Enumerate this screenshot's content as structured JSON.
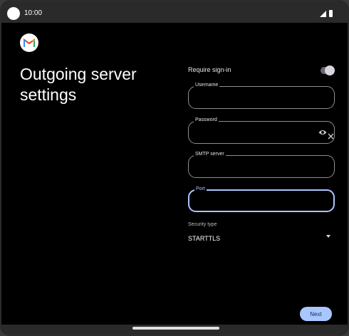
{
  "status_bar": {
    "time": "10:00"
  },
  "page": {
    "title": "Outgoing server settings"
  },
  "require_signin": {
    "label": "Require sign-in",
    "enabled": true
  },
  "fields": {
    "username": {
      "label": "Username",
      "value": ""
    },
    "password": {
      "label": "Password",
      "value": ""
    },
    "smtp_server": {
      "label": "SMTP server",
      "value": ""
    },
    "port": {
      "label": "Port",
      "value": ""
    }
  },
  "security": {
    "label": "Security type",
    "selected": "STARTTLS"
  },
  "actions": {
    "next_label": "Next"
  },
  "colors": {
    "accent": "#a9c7ff",
    "background": "#000000"
  },
  "icons": [
    "gmail-logo",
    "eye-icon",
    "close-icon",
    "dropdown-caret-icon"
  ]
}
